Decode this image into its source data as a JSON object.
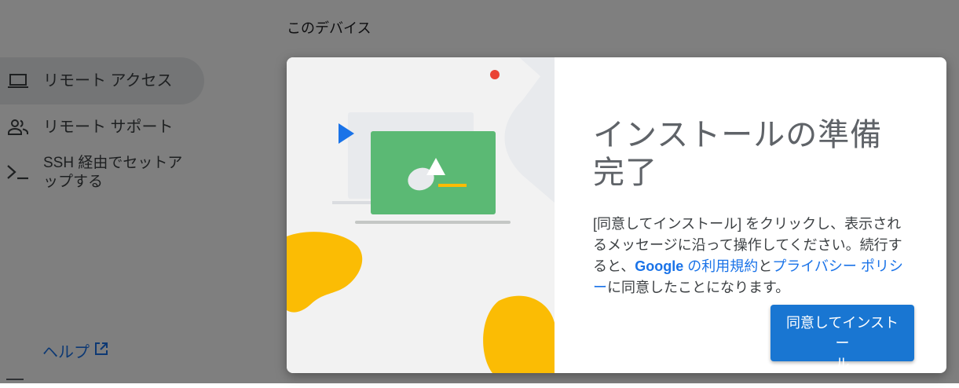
{
  "page": {
    "section_title": "このデバイス"
  },
  "sidebar": {
    "items": [
      {
        "id": "remote-access",
        "label": "リモート アクセス",
        "icon": "laptop-icon",
        "active": true
      },
      {
        "id": "remote-support",
        "label": "リモート サポート",
        "icon": "people-icon",
        "active": false
      },
      {
        "id": "ssh",
        "label_line1": "SSH 経由でセットア",
        "label_line2": "ップする",
        "icon": "terminal-icon",
        "active": false
      }
    ],
    "help": {
      "label": "ヘルプ",
      "icon": "open-in-new-icon"
    }
  },
  "dialog": {
    "title_line1": "インストールの準備",
    "title_line2": "完了",
    "body": {
      "text1": "[同意してインストール] をクリックし、表示されるメッセージに沿って操作してください。続行すると、",
      "google": "Google",
      "terms": " の利用規約",
      "text2": "と",
      "privacy": "プライバシー ポリシー",
      "text3": "に同意したことになります。"
    },
    "install_button": {
      "line1": "同意してインストー",
      "line2": "ル"
    }
  },
  "colors": {
    "accent": "#1a73e8",
    "button": "#1976d2",
    "illustration_green": "#5bb974",
    "illustration_yellow": "#fbbc04",
    "illustration_red": "#ea4335",
    "illustration_blue": "#1a73e8"
  }
}
